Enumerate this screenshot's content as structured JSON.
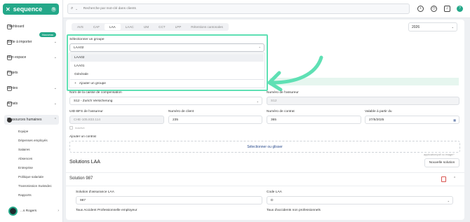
{
  "brand": {
    "name": "sequence",
    "mark": "✕",
    "color": "#24a889"
  },
  "sidebar": {
    "items": [
      {
        "label": "Dashboard",
        "icon": "home-icon"
      },
      {
        "label": "Boîte à importer",
        "icon": "inbox-icon"
      },
      {
        "label": "Mon espace",
        "icon": "user-icon"
      },
      {
        "label": "Projets",
        "icon": "folder-icon"
      },
      {
        "label": "Ventes",
        "icon": "tag-icon"
      },
      {
        "label": "Achats",
        "icon": "cart-icon"
      },
      {
        "label": "Ressources humaines",
        "icon": "people-icon"
      }
    ],
    "new_badge": "Nouveau",
    "subitems": [
      "Equipe",
      "Dépenses employés",
      "Salaires",
      "Absences",
      "Entreprise",
      "Politique salariale",
      "Transmission Swissdec",
      "Rapports"
    ],
    "user_name": "...s Rogers"
  },
  "topbar": {
    "search_placeholder": "Recherche par mot-clé dans clients",
    "help": "?"
  },
  "tabs": [
    "AVS",
    "CAF",
    "LAA",
    "LAAC",
    "IJM",
    "CCT",
    "LPP",
    "Rétentions cantonales"
  ],
  "active_tab": "LAA",
  "year": "2026",
  "group": {
    "label": "Sélectionner un groupe",
    "value": "LAA02",
    "options": [
      "LAA02",
      "LAA01",
      "Générale"
    ],
    "add": "Ajouter un groupe"
  },
  "fields": {
    "caisse_label": "Nom de la caisse de compensation",
    "caisse_value": "S12 - Zurich Versicherung",
    "assureur_label": "Numéro de l'assureur",
    "assureur_value": "S12",
    "uid_label": "UID-BFS de l'assureur",
    "uid_value": "CHE-105.833.114",
    "client_label": "Numéro de client",
    "client_value": "235",
    "contrat_label": "Numéro de contrat",
    "contrat_value": "365",
    "valable_label": "Valable à partir du",
    "valable_value": "27/5/2025",
    "inactive_label": "Inactive",
    "add_contract_label": "Ajouter un contrat",
    "drop_text": "Sélectionner ou glisser"
  },
  "solutions": {
    "title": "Solutions LAA",
    "hint": "application/pdf ou image/*",
    "new_button": "Nouvelle solution",
    "solution_title": "Solution 987",
    "sol_label": "Solution d'assurance LAA",
    "sol_value": "987",
    "code_label": "Code LAA",
    "code_value": "D",
    "taux_pro_label": "Taux Accident Professionnelle employeur",
    "taux_npro_label": "Taux d'accidents non professionnels"
  },
  "colors": {
    "accent": "#24a889",
    "highlight": "#5fe0b4",
    "link": "#2a4b8d",
    "danger": "#d9534f"
  }
}
